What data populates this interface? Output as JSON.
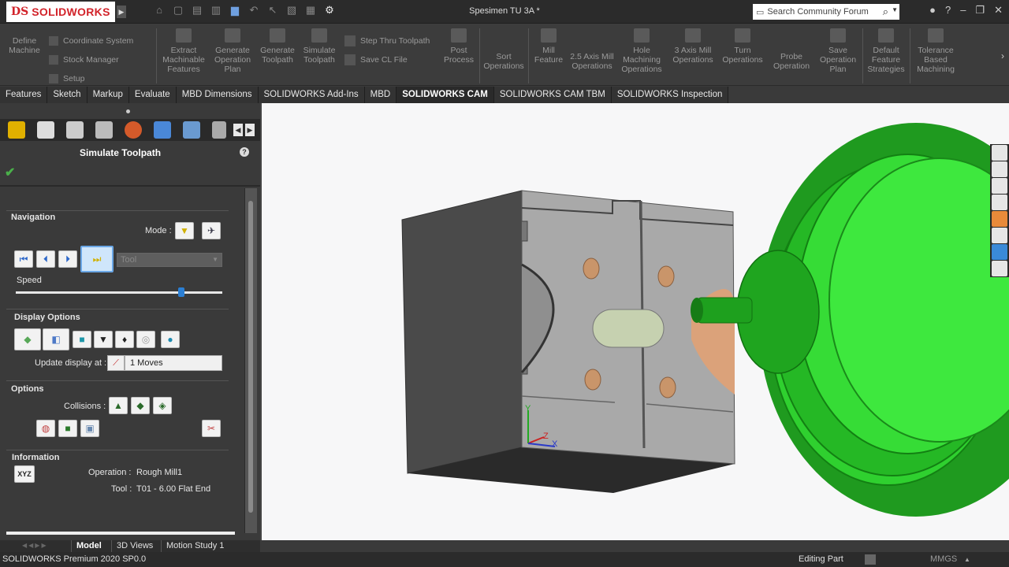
{
  "app": {
    "brand_ds": "DS",
    "brand": "SOLIDWORKS",
    "document_title": "Spesimen TU 3A *",
    "search_placeholder": "Search Community Forum"
  },
  "ribbon": {
    "define_machine": "Define Machine",
    "coordinate_system": "Coordinate System",
    "stock_manager": "Stock Manager",
    "setup": "Setup",
    "extract_features": "Extract Machinable Features",
    "generate_plan": "Generate Operation Plan",
    "generate_toolpath": "Generate Toolpath",
    "simulate_toolpath": "Simulate Toolpath",
    "step_thru": "Step Thru Toolpath",
    "save_cl": "Save CL File",
    "post_process": "Post Process",
    "sort_operations": "Sort Operations",
    "mill_feature": "Mill Feature",
    "axis25": "2.5 Axis Mill Operations",
    "hole_machining": "Hole Machining Operations",
    "axis3": "3 Axis Mill Operations",
    "turn_operations": "Turn Operations",
    "probe_operation": "Probe Operation",
    "save_plan": "Save Operation Plan",
    "default_strategies": "Default Feature Strategies",
    "tolerance_based": "Tolerance Based Machining"
  },
  "command_tabs": [
    "Features",
    "Sketch",
    "Markup",
    "Evaluate",
    "MBD Dimensions",
    "SOLIDWORKS Add-Ins",
    "MBD",
    "SOLIDWORKS CAM",
    "SOLIDWORKS CAM TBM",
    "SOLIDWORKS Inspection"
  ],
  "active_command_tab": "SOLIDWORKS CAM",
  "property_manager": {
    "title": "Simulate Toolpath",
    "help": "?",
    "navigation": {
      "title": "Navigation",
      "mode_label": "Mode :",
      "speed_label": "Speed",
      "speed_fraction": 0.8,
      "dropdown_value": "Tool"
    },
    "display_options": {
      "title": "Display Options",
      "update_label": "Update display at :",
      "update_value": "1 Moves"
    },
    "options": {
      "title": "Options",
      "collisions_label": "Collisions :"
    },
    "information": {
      "title": "Information",
      "xyz_label": "XYZ",
      "operation_label": "Operation :",
      "operation_value": "Rough Mill1",
      "tool_label": "Tool :",
      "tool_value": "T01 - 6.00 Flat End"
    }
  },
  "bottom_tabs": [
    "Model",
    "3D Views",
    "Motion Study 1"
  ],
  "status": {
    "left": "SOLIDWORKS Premium 2020 SP0.0",
    "middle": "Editing Part",
    "units": "MMGS"
  },
  "colors": {
    "brand_red": "#d2232a",
    "tool_green": "#2fd02f",
    "stock_gray": "#a9a9a9",
    "accent_blue": "#2b7fd4"
  }
}
